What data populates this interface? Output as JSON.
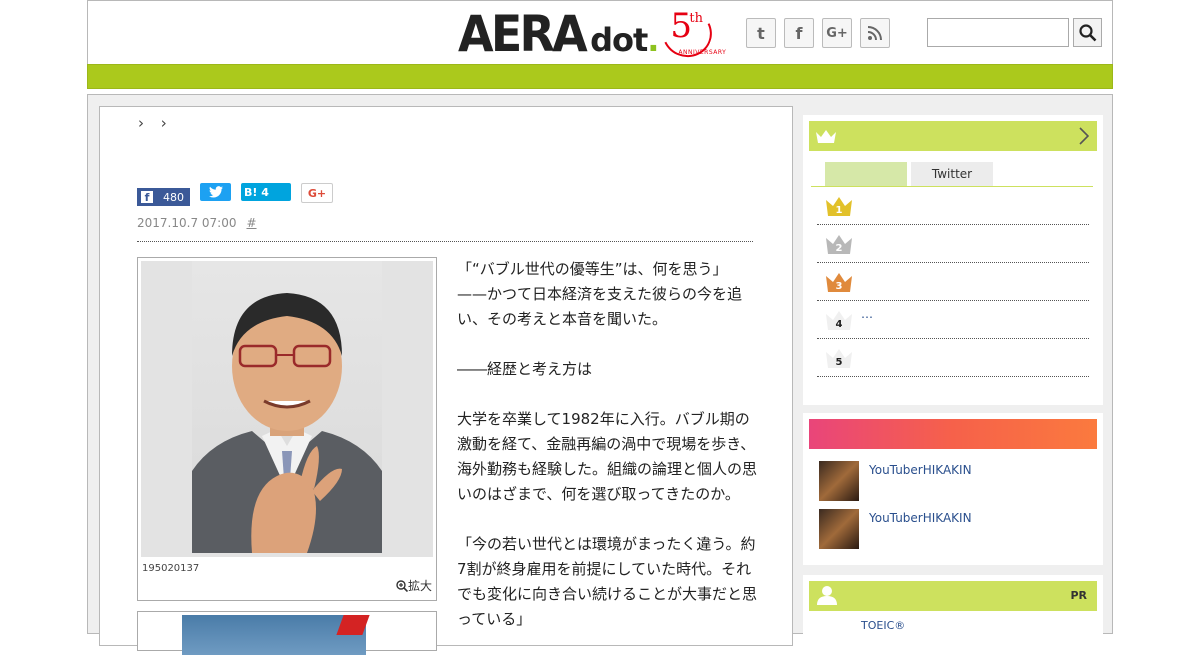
{
  "header": {
    "logo_main": "AERA",
    "logo_sub": "dot",
    "logo_period": ".",
    "anniversary_number": "5",
    "anniversary_suffix": "th",
    "anniversary_text": "ANNIVERSARY",
    "social": [
      {
        "icon": "twitter-icon",
        "glyph": "t"
      },
      {
        "icon": "facebook-icon",
        "glyph": "f"
      },
      {
        "icon": "google-plus-icon",
        "glyph": "G+"
      },
      {
        "icon": "rss-icon",
        "glyph": "⌇"
      }
    ],
    "search_placeholder": ""
  },
  "breadcrumb": {
    "separators": "› ›"
  },
  "share": {
    "facebook_glyph": "f",
    "facebook_count": "480",
    "twitter_glyph": "t",
    "hatena_label": "B!",
    "hatena_count": "4",
    "google_label": "G+"
  },
  "article": {
    "date": "2017.10.7 07:00",
    "hash": "#",
    "photo_caption": "195020137",
    "enlarge_label": "拡大",
    "paragraphs": [
      "「“バブル世代の優等生”は、何を思う」——かつて日本経済を支えた彼らの今を追い、その考えと本音を聞いた。",
      "――経歴と考え方は",
      "大学を卒業して1982年に入行。バブル期の激動を経て、金融再編の渦中で現場を歩き、海外勤務も経験した。組織の論理と個人の思いのはざまで、何を選び取ってきたのか。",
      "「今の若い世代とは環境がまったく違う。約7割が終身雇用を前提にしていた時代。それでも変化に向き合い続けることが大事だと思っている」"
    ]
  },
  "sidebar": {
    "ranking": {
      "tab_a": "",
      "tab_b": "Twitter",
      "rows": [
        {
          "num": "1",
          "color": "#e2c12a",
          "text": ""
        },
        {
          "num": "2",
          "color": "#b8b8b8",
          "text": ""
        },
        {
          "num": "3",
          "color": "#e08a3c",
          "text": ""
        },
        {
          "num": "4",
          "color": "#f0f0f0",
          "text": "…"
        },
        {
          "num": "5",
          "color": "#f0f0f0",
          "text": ""
        }
      ]
    },
    "hot": [
      {
        "text": "YouTuberHIKAKIN"
      },
      {
        "text": "YouTuberHIKAKIN"
      }
    ],
    "pr": {
      "label": "PR",
      "item": "TOEIC®"
    }
  },
  "colors": {
    "accent_green": "#abc91c",
    "sidebar_green": "#cde15e",
    "link_blue": "#2a4f8d"
  }
}
